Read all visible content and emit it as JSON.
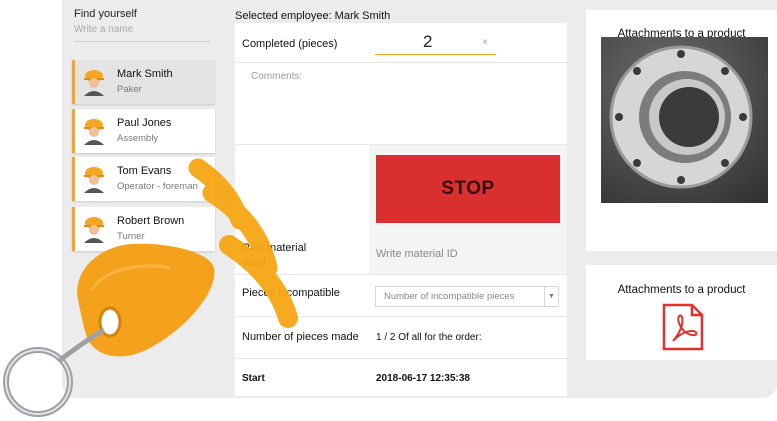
{
  "left_panel": {
    "title": "Find yourself",
    "search_placeholder": "Write a name",
    "employees": [
      {
        "name": "Mark Smith",
        "role": "Paker",
        "selected": true
      },
      {
        "name": "Paul Jones",
        "role": "Assembly",
        "selected": false
      },
      {
        "name": "Tom Evans",
        "role": "Operator - foreman",
        "selected": false
      },
      {
        "name": "Robert Brown",
        "role": "Turner",
        "selected": false
      }
    ]
  },
  "form": {
    "selected_employee": "Selected employee: Mark Smith",
    "completed_label": "Completed (pieces)",
    "completed_value": "2",
    "clear_icon": "×",
    "comments_label": "Comments:",
    "stop_label": "STOP",
    "raw_material_label": "Raw material used",
    "raw_material_placeholder": "Write material ID",
    "incompatible_label": "Pieces incompatible",
    "incompatible_placeholder": "Number of incompatible pieces",
    "pieces_made_label": "Number of pieces made",
    "pieces_made_value": "1 / 2   Of all for the order:",
    "start_label": "Start",
    "start_value": "2018-06-17 12:35:38"
  },
  "attachments": {
    "title1": "Attachments to a product",
    "title2": "Attachments to a product",
    "image_icon": "flange-photo",
    "file_icon": "pdf-icon"
  },
  "colors": {
    "accent": "#f5a623",
    "stop": "#d92f2f",
    "pdf": "#e0312e",
    "fob": "#f6a614"
  }
}
